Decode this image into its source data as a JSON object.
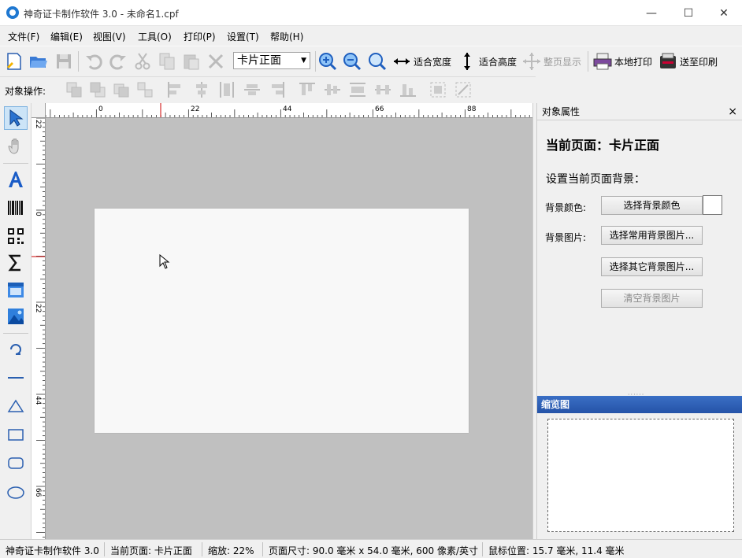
{
  "window": {
    "title": "神奇证卡制作软件 3.0 - 未命名1.cpf",
    "minimize": "—",
    "maximize": "☐",
    "close": "✕"
  },
  "menu": [
    {
      "label": "文件(F)"
    },
    {
      "label": "编辑(E)"
    },
    {
      "label": "视图(V)"
    },
    {
      "label": "工具(O)"
    },
    {
      "label": "打印(P)"
    },
    {
      "label": "设置(T)"
    },
    {
      "label": "帮助(H)"
    }
  ],
  "toolbar": {
    "page_select": "卡片正面",
    "fit_width": "适合宽度",
    "fit_height": "适合高度",
    "fit_page": "整页显示",
    "local_print": "本地打印",
    "send_print": "送至印刷"
  },
  "objbar": {
    "label": "对象操作:"
  },
  "ruler": {
    "h_labels": [
      "0",
      "22",
      "44",
      "66",
      "88"
    ],
    "v_labels": [
      "22",
      "0",
      "22",
      "44",
      "66"
    ]
  },
  "props": {
    "header": "对象属性",
    "close": "×",
    "current_page": "当前页面：卡片正面",
    "bg_title": "设置当前页面背景：",
    "bg_color_label": "背景颜色:",
    "bg_color_button": "选择背景颜色",
    "bg_image_label": "背景图片:",
    "bg_common_button": "选择常用背景图片...",
    "bg_other_button": "选择其它背景图片...",
    "bg_clear_button": "清空背景图片"
  },
  "preview": {
    "header": "缩览图"
  },
  "status": {
    "app": "神奇证卡制作软件 3.0",
    "page": "当前页面: 卡片正面",
    "zoom": "缩放: 22%",
    "size": "页面尺寸: 90.0 毫米 x 54.0 毫米, 600 像素/英寸",
    "mouse": "鼠标位置: 15.7 毫米, 11.4 毫米"
  },
  "colors": {
    "accent": "#1f78d1",
    "preview_header": "#2553a8",
    "canvas_bg": "#c0c0c0"
  }
}
